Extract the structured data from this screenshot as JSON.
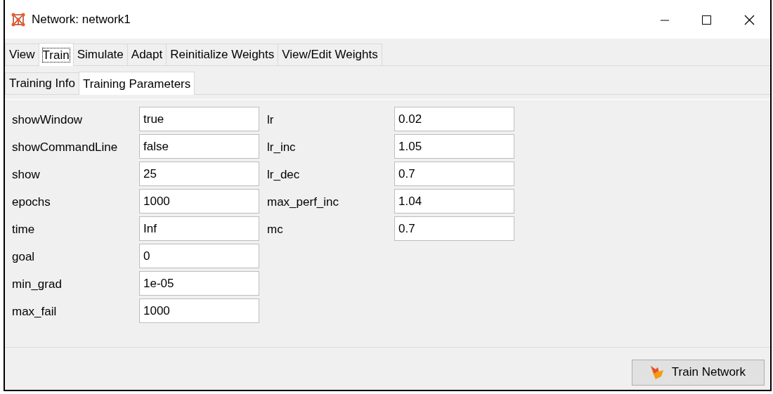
{
  "window": {
    "title": "Network: network1"
  },
  "tabs": [
    {
      "label": "View",
      "selected": false
    },
    {
      "label": "Train",
      "selected": true
    },
    {
      "label": "Simulate",
      "selected": false
    },
    {
      "label": "Adapt",
      "selected": false
    },
    {
      "label": "Reinitialize Weights",
      "selected": false
    },
    {
      "label": "View/Edit Weights",
      "selected": false
    }
  ],
  "subtabs": [
    {
      "label": "Training Info",
      "selected": false
    },
    {
      "label": "Training Parameters",
      "selected": true
    }
  ],
  "parameters_left": [
    {
      "label": "showWindow",
      "value": "true"
    },
    {
      "label": "showCommandLine",
      "value": "false"
    },
    {
      "label": "show",
      "value": "25"
    },
    {
      "label": "epochs",
      "value": "1000"
    },
    {
      "label": "time",
      "value": "Inf"
    },
    {
      "label": "goal",
      "value": "0"
    },
    {
      "label": "min_grad",
      "value": "1e-05"
    },
    {
      "label": "max_fail",
      "value": "1000"
    }
  ],
  "parameters_right": [
    {
      "label": "lr",
      "value": "0.02"
    },
    {
      "label": "lr_inc",
      "value": "1.05"
    },
    {
      "label": "lr_dec",
      "value": "0.7"
    },
    {
      "label": "max_perf_inc",
      "value": "1.04"
    },
    {
      "label": "mc",
      "value": "0.7"
    }
  ],
  "train_button": {
    "label": "Train Network"
  }
}
